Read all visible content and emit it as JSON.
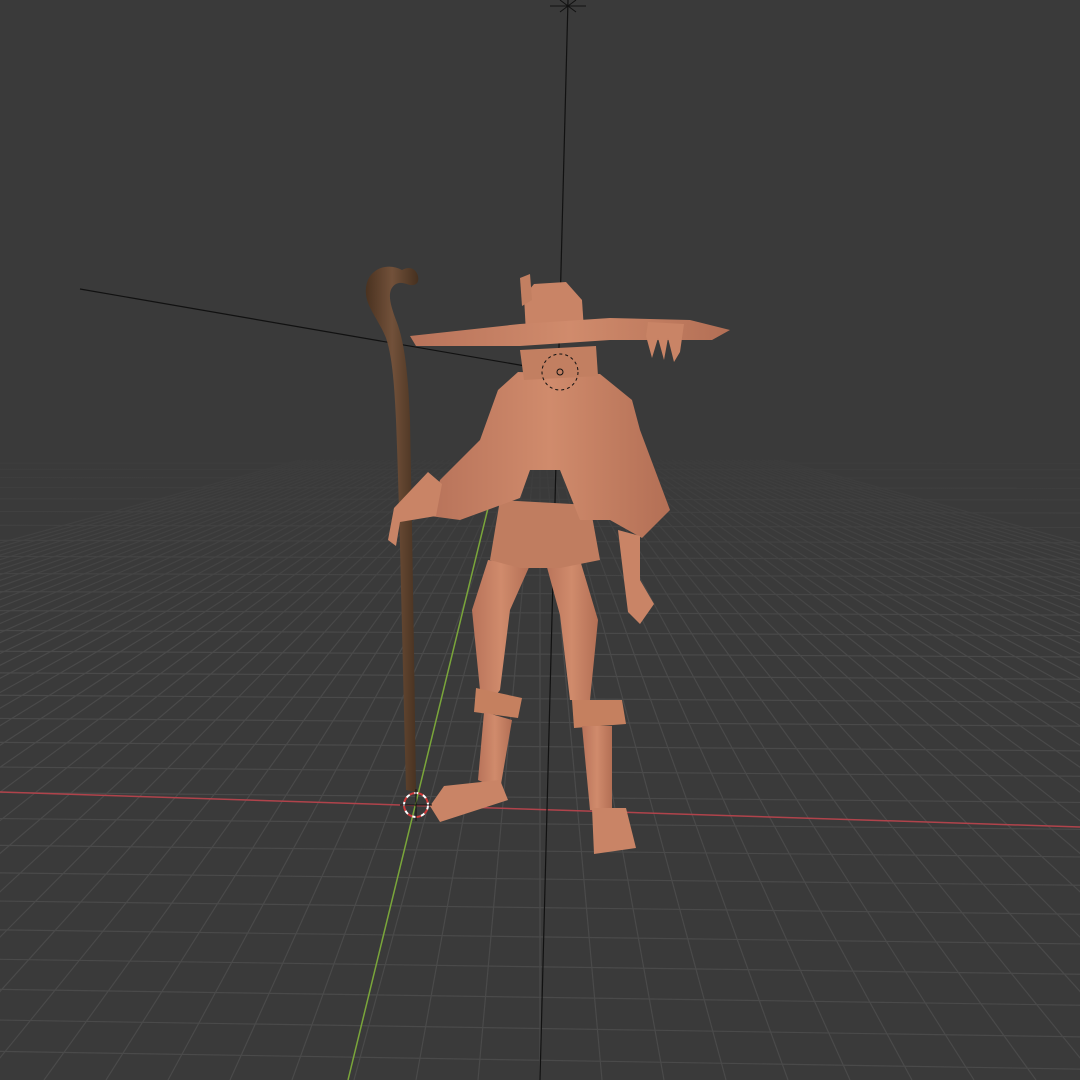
{
  "viewport": {
    "kind": "3d-viewport",
    "background": "#3a3a3a",
    "grid": true,
    "grid_color": "#4a4a4a",
    "axes": {
      "x_color": "#b0434b",
      "y_color": "#7aa63a",
      "z_color": "#111111"
    },
    "object": {
      "body_color": "#c98466",
      "staff_color": "#5e4128",
      "selected": false
    }
  }
}
